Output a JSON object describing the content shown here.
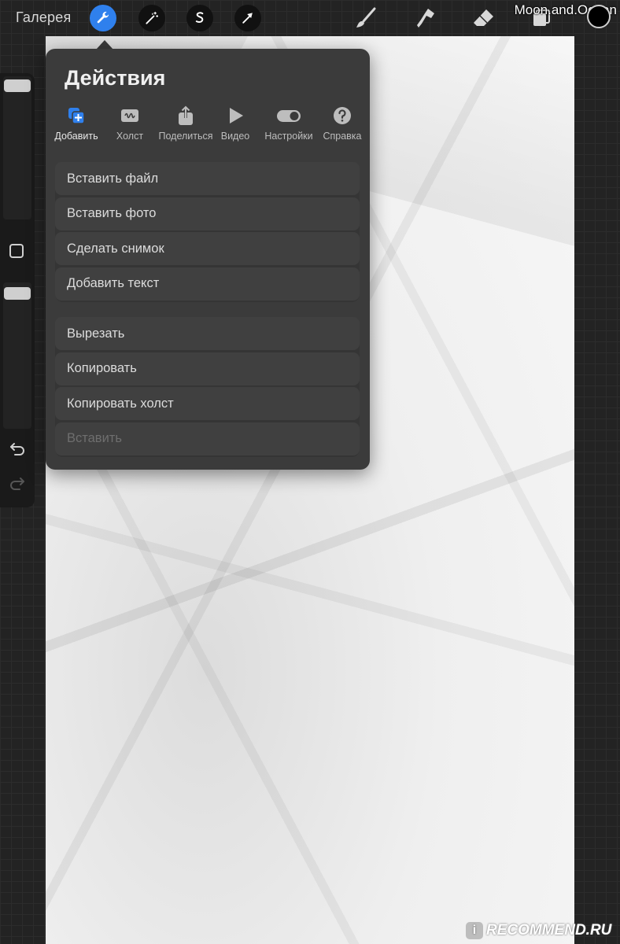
{
  "topbar": {
    "gallery_label": "Галерея",
    "watermark": "Moon.and.Ocean",
    "buttons": [
      "wrench-icon",
      "magic-wand-icon",
      "selection-s-icon",
      "transform-arrow-icon"
    ],
    "tools": [
      "brush-icon",
      "smudge-icon",
      "eraser-icon",
      "layers-icon"
    ],
    "active_color": "#000000",
    "accent": "#2f80ed"
  },
  "popover": {
    "title": "Действия",
    "tabs": [
      {
        "label": "Добавить",
        "icon": "add-layer-icon",
        "active": true
      },
      {
        "label": "Холст",
        "icon": "canvas-icon",
        "active": false
      },
      {
        "label": "Поделиться",
        "icon": "share-icon",
        "active": false
      },
      {
        "label": "Видео",
        "icon": "play-icon",
        "active": false
      },
      {
        "label": "Настройки",
        "icon": "toggle-icon",
        "active": false
      },
      {
        "label": "Справка",
        "icon": "help-icon",
        "active": false
      }
    ],
    "group1": [
      "Вставить файл",
      "Вставить фото",
      "Сделать снимок",
      "Добавить текст"
    ],
    "group2": [
      "Вырезать",
      "Копировать",
      "Копировать холст"
    ],
    "disabled_item": "Вставить"
  },
  "sidebar": {
    "icons": [
      "undo-icon",
      "redo-icon"
    ]
  },
  "footer_watermark": {
    "badge": "i",
    "text": "RECOMMEND.RU"
  }
}
